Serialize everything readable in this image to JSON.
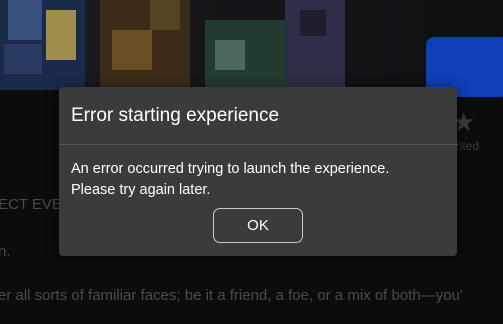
{
  "background": {
    "favorite_label": "orited",
    "text_line_1": "ECT EVE",
    "text_line_2": "n.",
    "text_line_3": "er all sorts of familiar faces; be it a friend, a foe, or a mix of both—you'"
  },
  "dialog": {
    "title": "Error starting experience",
    "message_line_1": "An error occurred trying to launch the experience.",
    "message_line_2": "Please try again later.",
    "ok_label": "OK"
  },
  "icons": {
    "favorite": "star-icon"
  },
  "colors": {
    "dialog_bg": "#393b3d",
    "page_bg": "#0c0c0d",
    "accent_tile": "#0f3fb8"
  }
}
